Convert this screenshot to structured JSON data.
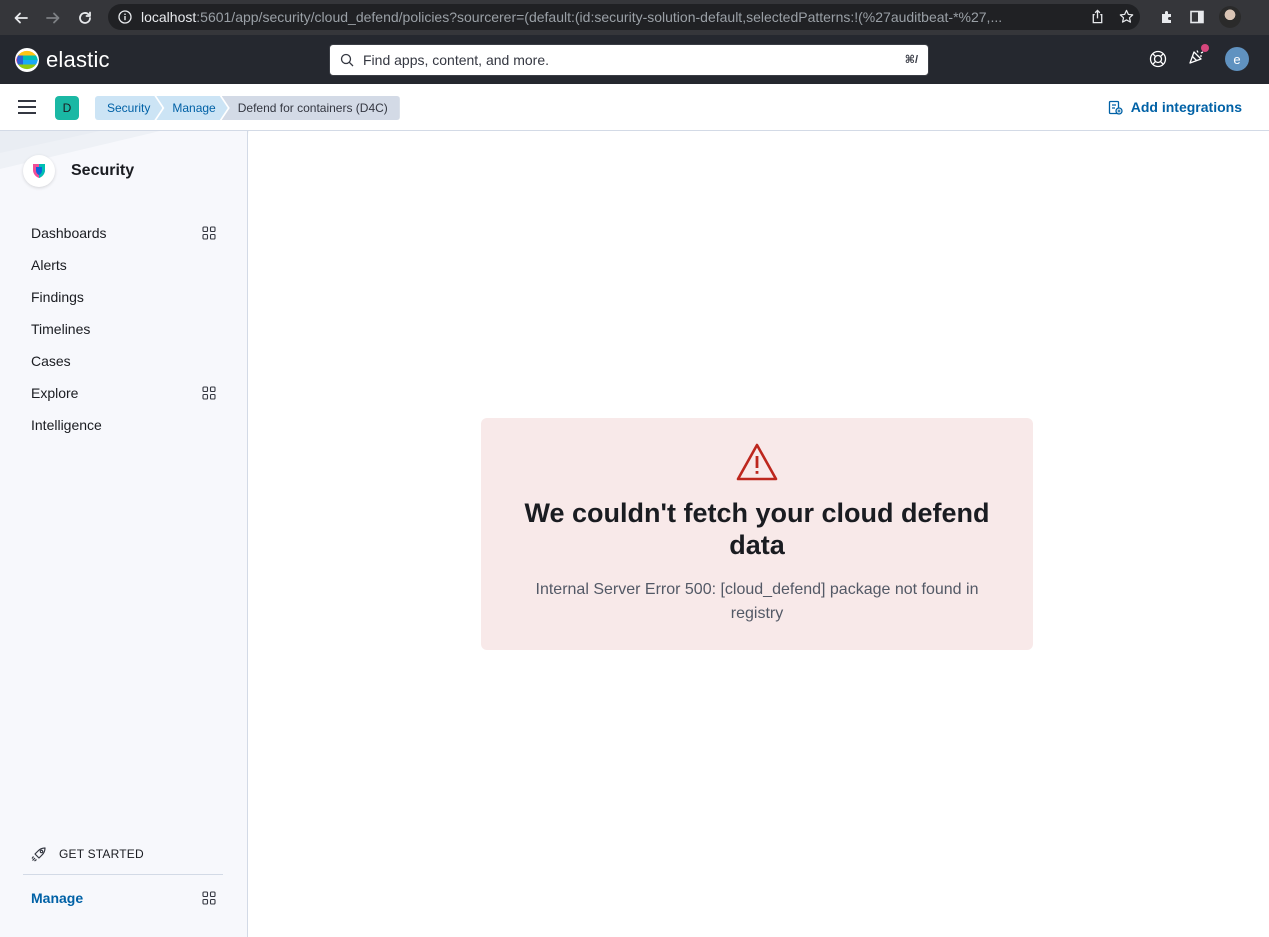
{
  "browser": {
    "url_host": "localhost",
    "url_rest": ":5601/app/security/cloud_defend/policies?sourcerer=(default:(id:security-solution-default,selectedPatterns:!(%27auditbeat-*%27,..."
  },
  "header": {
    "logo_text": "elastic",
    "search_placeholder": "Find apps, content, and more.",
    "search_shortcut": "⌘/",
    "user_initial": "e"
  },
  "subheader": {
    "space_initial": "D",
    "breadcrumbs": [
      "Security",
      "Manage",
      "Defend for containers (D4C)"
    ],
    "add_integrations": "Add integrations"
  },
  "sidebar": {
    "title": "Security",
    "items": [
      {
        "label": "Dashboards",
        "has_grid": true
      },
      {
        "label": "Alerts",
        "has_grid": false
      },
      {
        "label": "Findings",
        "has_grid": false
      },
      {
        "label": "Timelines",
        "has_grid": false
      },
      {
        "label": "Cases",
        "has_grid": false
      },
      {
        "label": "Explore",
        "has_grid": true
      },
      {
        "label": "Intelligence",
        "has_grid": false
      }
    ],
    "get_started": "GET STARTED",
    "manage": "Manage"
  },
  "error": {
    "title": "We couldn't fetch your cloud defend data",
    "body": "Internal Server Error 500: [cloud_defend] package not found in registry"
  },
  "colors": {
    "accent": "#0061a6",
    "error_panel_bg": "#f8e9e9",
    "warning_icon": "#bd271e",
    "header_bg": "#25282f"
  }
}
